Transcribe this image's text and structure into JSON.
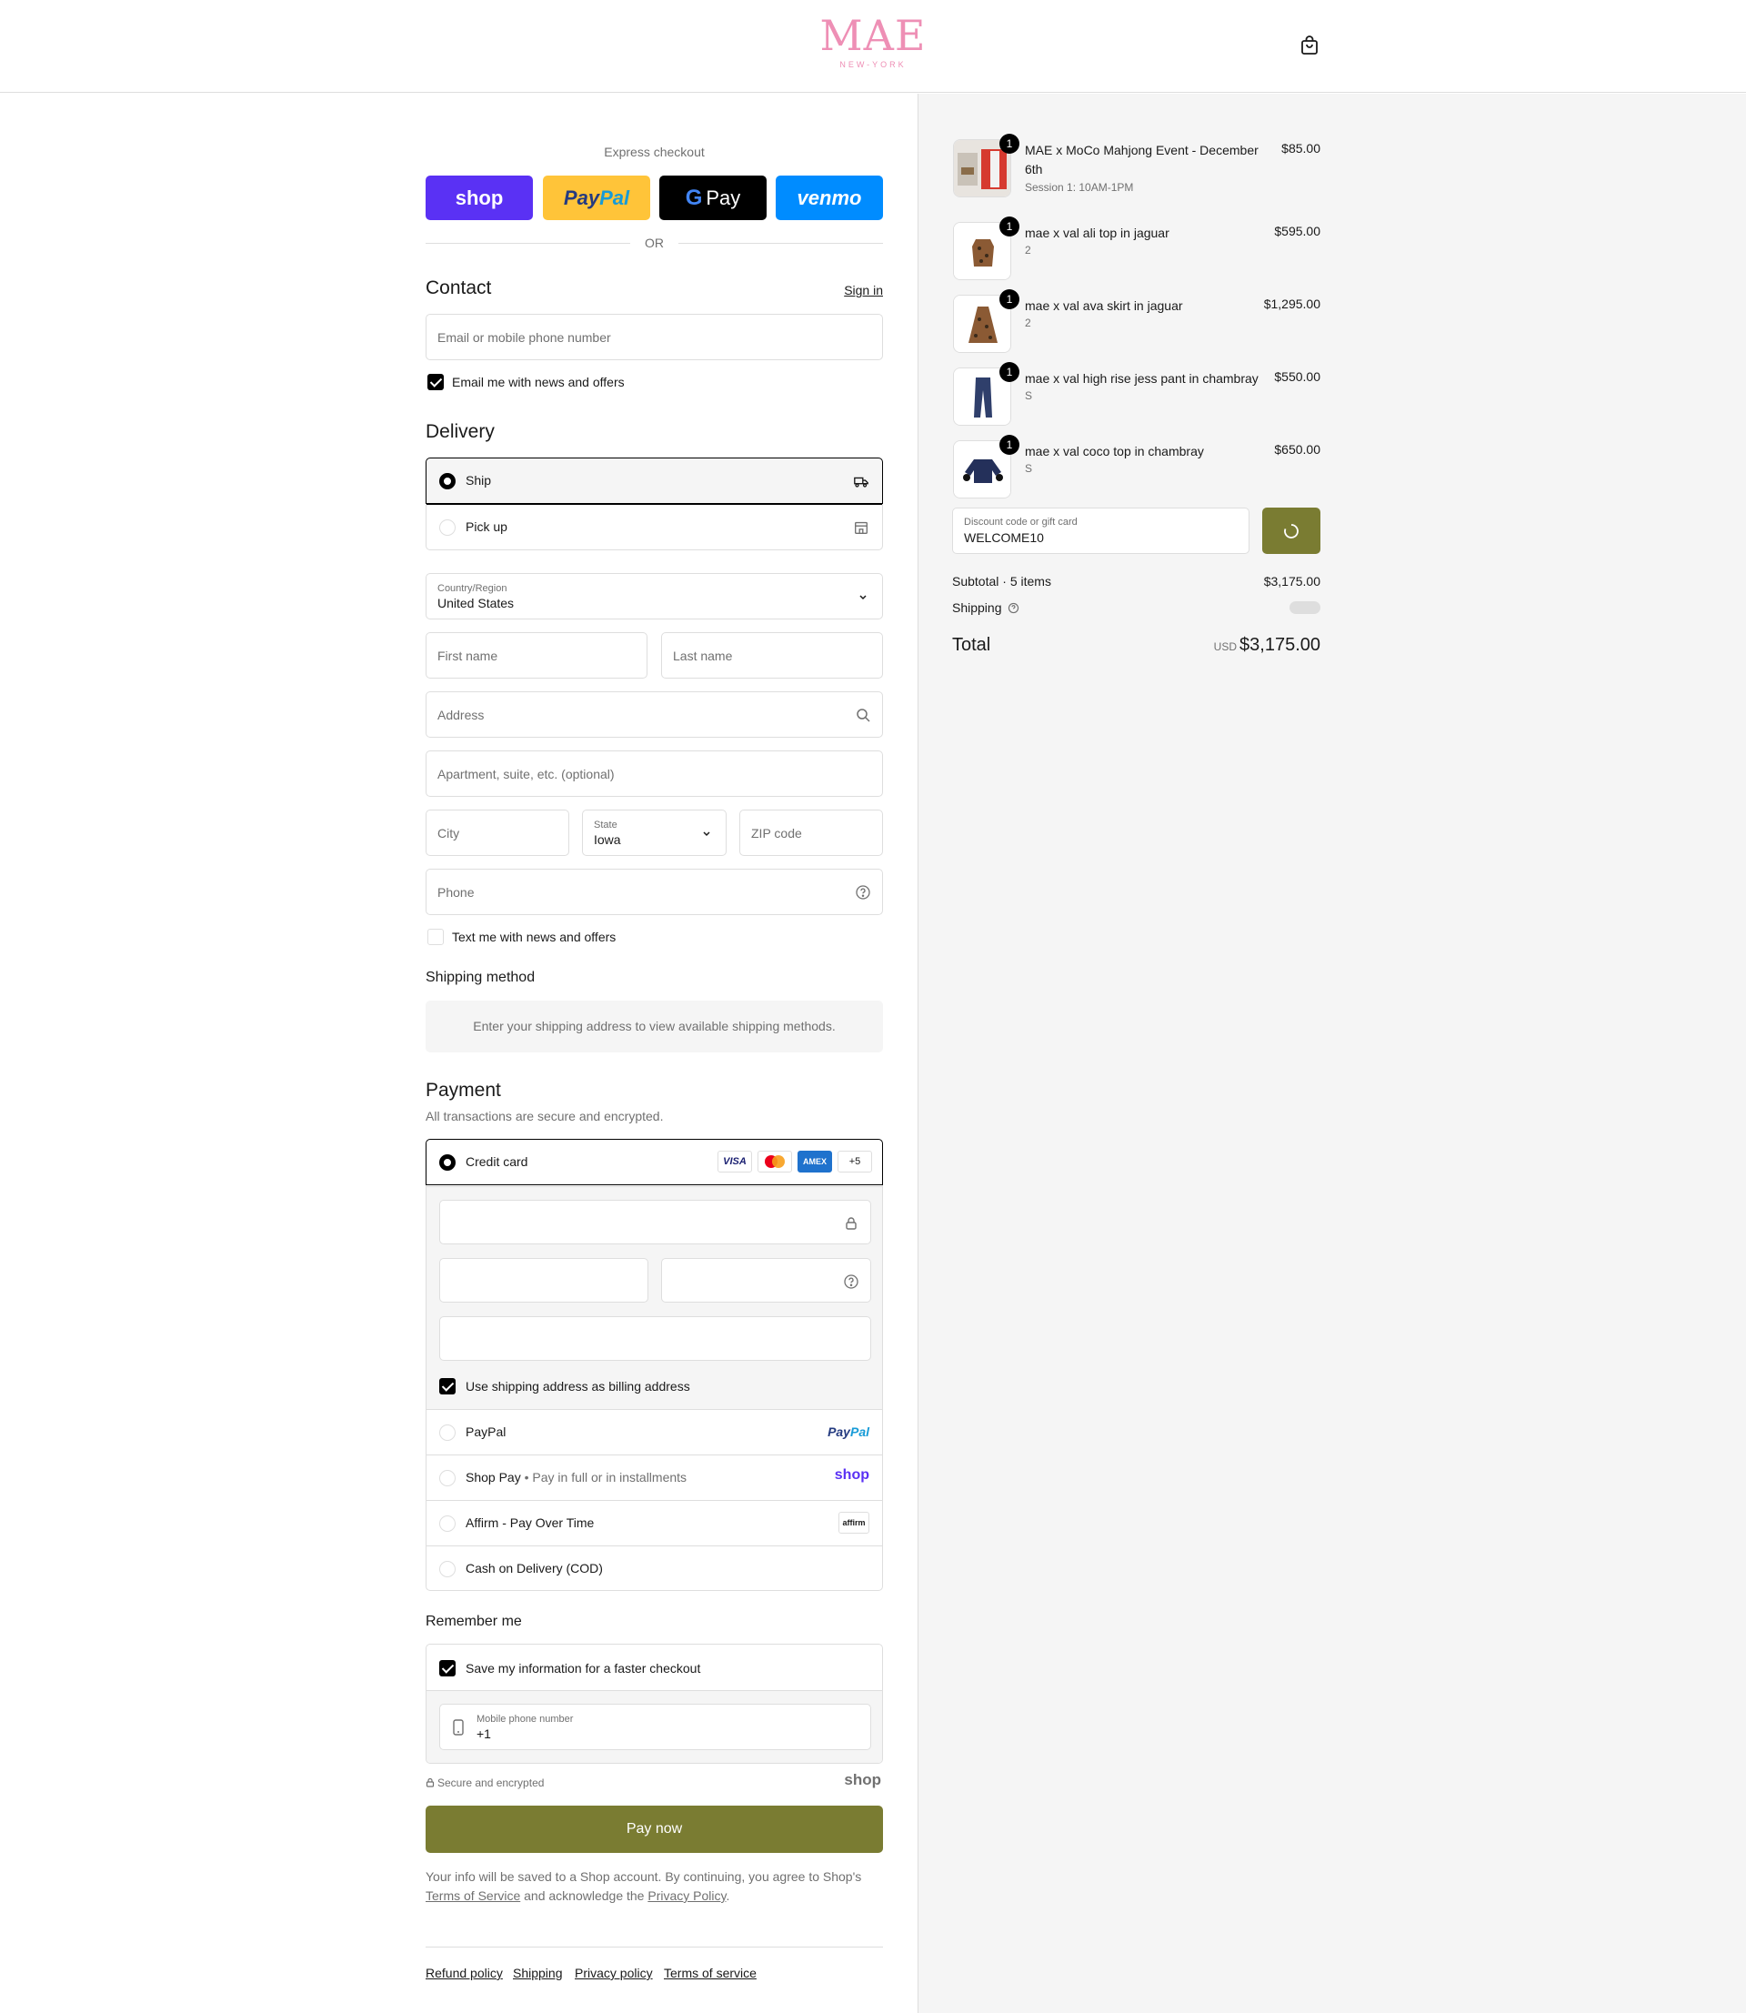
{
  "brand": {
    "name": "MAE",
    "sub": "NEW-YORK"
  },
  "express": {
    "label": "Express checkout",
    "shop": "shop",
    "paypal_a": "Pay",
    "paypal_b": "Pal",
    "gpay_g": "G",
    "gpay": "Pay",
    "venmo": "venmo",
    "or": "OR"
  },
  "contact": {
    "title": "Contact",
    "signin": "Sign in",
    "email_placeholder": "Email or mobile phone number",
    "news_label": "Email me with news and offers"
  },
  "delivery": {
    "title": "Delivery",
    "options": [
      {
        "label": "Ship",
        "icon": "truck-icon"
      },
      {
        "label": "Pick up",
        "icon": "store-icon"
      }
    ],
    "country_label": "Country/Region",
    "country_value": "United States",
    "first_name": "First name",
    "last_name": "Last name",
    "address": "Address",
    "apartment": "Apartment, suite, etc. (optional)",
    "city": "City",
    "state_label": "State",
    "state_value": "Iowa",
    "zip": "ZIP code",
    "phone": "Phone",
    "text_label": "Text me with news and offers"
  },
  "shipping_method": {
    "title": "Shipping method",
    "message": "Enter your shipping address to view available shipping methods."
  },
  "payment": {
    "title": "Payment",
    "subtitle": "All transactions are secure and encrypted.",
    "credit_card": "Credit card",
    "card_visa": "VISA",
    "card_amex": "AMEX",
    "card_more": "+5",
    "billing_label": "Use shipping address as billing address",
    "paypal": "PayPal",
    "paypal_logo_a": "Pay",
    "paypal_logo_b": "Pal",
    "shoppay": "Shop Pay",
    "shoppay_sep": "•",
    "shoppay_desc": "Pay in full or in installments",
    "shoppay_logo": "shop",
    "affirm": "Affirm - Pay Over Time",
    "affirm_logo": "affirm",
    "cod": "Cash on Delivery (COD)"
  },
  "remember": {
    "title": "Remember me",
    "save_label": "Save my information for a faster checkout",
    "mobile_label": "Mobile phone number",
    "mobile_value": "+1",
    "secure": "Secure and encrypted",
    "shop_logo": "shop"
  },
  "pay_now": "Pay now",
  "legal": {
    "part1": "Your info will be saved to a Shop account. By continuing, you agree to Shop's",
    "terms": "Terms of Service",
    "part2": "and acknowledge the",
    "privacy": "Privacy Policy",
    "part3": "."
  },
  "footer": [
    "Refund policy",
    "Shipping",
    "Privacy policy",
    "Terms of service"
  ],
  "order": {
    "items": [
      {
        "qty": "1",
        "name": "MAE x MoCo Mahjong Event - December 6th",
        "variant": "Session 1: 10AM-1PM",
        "price": "$85.00"
      },
      {
        "qty": "1",
        "name": "mae x val ali top in jaguar",
        "variant": "2",
        "price": "$595.00"
      },
      {
        "qty": "1",
        "name": "mae x val ava skirt in jaguar",
        "variant": "2",
        "price": "$1,295.00"
      },
      {
        "qty": "1",
        "name": "mae x val high rise jess pant in chambray",
        "variant": "S",
        "price": "$550.00"
      },
      {
        "qty": "1",
        "name": "mae x val coco top in chambray",
        "variant": "S",
        "price": "$650.00"
      }
    ],
    "discount_label": "Discount code or gift card",
    "discount_value": "WELCOME10",
    "subtotal_label": "Subtotal · 5 items",
    "subtotal_value": "$3,175.00",
    "shipping_label": "Shipping",
    "total_label": "Total",
    "currency": "USD",
    "total_value": "$3,175.00"
  },
  "colors": {
    "accent": "#7a7c32",
    "brand_pink": "#ee8fb5",
    "shop_purple": "#5a31f4",
    "paypal_yellow": "#ffc439",
    "venmo_blue": "#008cff"
  }
}
